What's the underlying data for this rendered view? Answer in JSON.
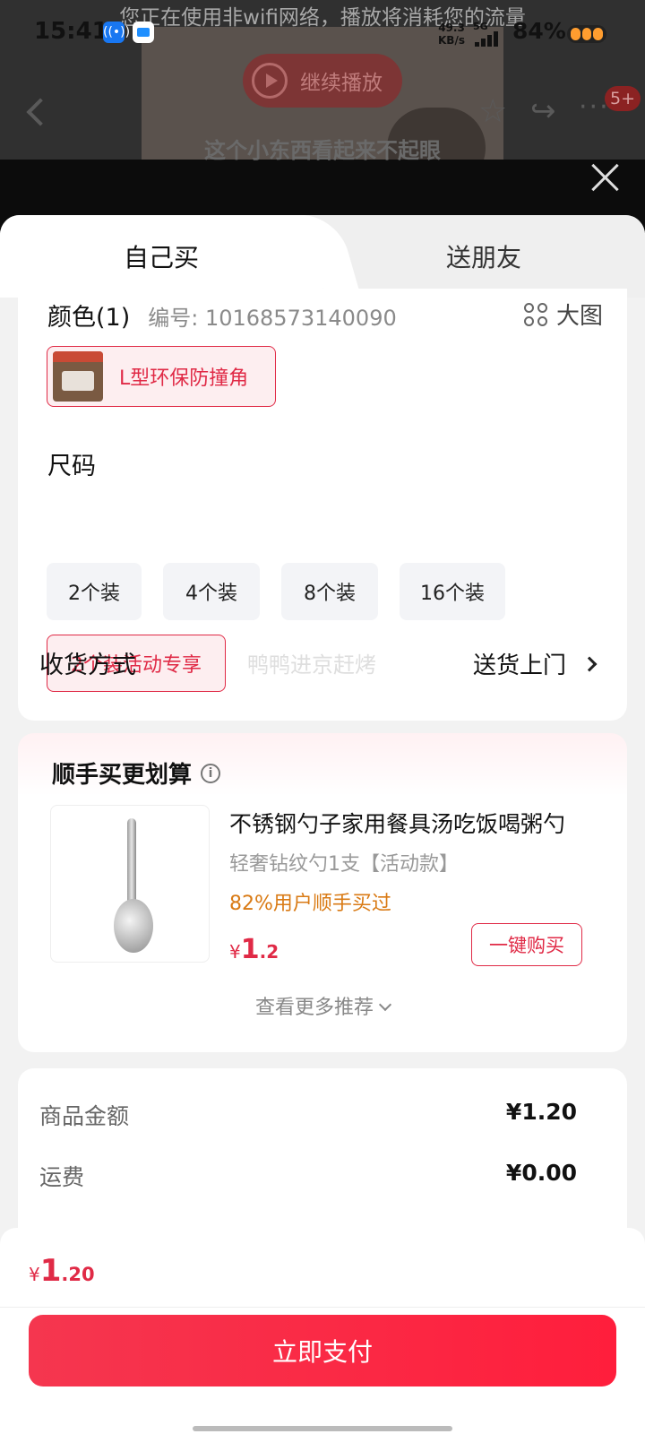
{
  "status_bar": {
    "time": "15:41",
    "net_speed_value": "49.3",
    "net_speed_unit": "KB/s",
    "network": "5G",
    "battery": "84%"
  },
  "video": {
    "wifi_warning": "您正在使用非wifi网络，播放将消耗您的流量",
    "continue_label": "继续播放",
    "subtitle": "这个小东西看起来不起眼",
    "message_badge": "5+"
  },
  "tabs": {
    "self": "自己买",
    "friend": "送朋友"
  },
  "spec": {
    "color_title": "颜色(1)",
    "item_no": "编号: 10168573140090",
    "big_pic": "大图",
    "color_option": "L型环保防撞角",
    "size_title": "尺码",
    "sizes": [
      "2个装",
      "4个装",
      "8个装",
      "16个装",
      "2个装活动专享"
    ],
    "delivery_label": "收货方式",
    "watermark": "鸭鸭进京赶烤",
    "delivery_value": "送货上门"
  },
  "addon": {
    "title": "顺手买更划算",
    "product_name": "不锈钢勺子家用餐具汤吃饭喝粥勺",
    "product_spec": "轻奢钻纹勺1支【活动款】",
    "buy_rate": "82%用户顺手买过",
    "price_currency": "¥",
    "price_int": "1",
    "price_dec": ".2",
    "buy_button": "一键购买",
    "more": "查看更多推荐"
  },
  "summary": {
    "goods_label": "商品金额",
    "goods_value": "¥1.20",
    "shipping_label": "运费",
    "shipping_value": "¥0.00"
  },
  "pay": {
    "currency": "¥",
    "total_int": "1",
    "total_dec": ".20",
    "button": "立即支付"
  },
  "colors": {
    "accent": "#e02a46",
    "orange": "#d97a14"
  }
}
